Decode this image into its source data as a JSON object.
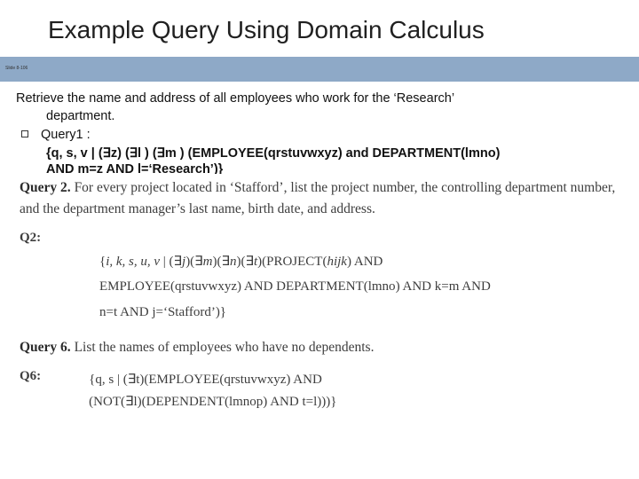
{
  "title": "Example Query Using Domain Calculus",
  "banner": "Slide 8-106",
  "intro_line1": "Retrieve the name and address of all employees who work for the ‘Research’",
  "intro_line2": "department.",
  "bullet_label": "Query1 :",
  "formula_line1": "{q, s, v | (∃z) (∃l ) (∃m ) (EMPLOYEE(qrstuvwxyz) and DEPARTMENT(lmno)",
  "formula_line2": "AND m=z AND l=‘Research’)}",
  "query2": {
    "label": "Query 2.",
    "desc": "For every project located in ‘Stafford’, list the project number, the controlling department number, and the department manager’s last name, birth date, and address.",
    "qlabel": "Q2:",
    "math1_a": "{",
    "math1_vars": "i, k, s, u, v",
    "math1_b": " | (∃",
    "math1_j": "j",
    "math1_c": ")(∃",
    "math1_m": "m",
    "math1_d": ")(∃",
    "math1_n": "n",
    "math1_e": ")(∃",
    "math1_t": "t",
    "math1_f": ")(PROJECT(",
    "math1_hijk": "hijk",
    "math1_g": ") AND",
    "math2_a": "EMPLOYEE(",
    "math2_emp": "qrstuvwxyz",
    "math2_b": ") AND DEPARTMENT(",
    "math2_dept": "lmno",
    "math2_c": ") AND ",
    "math2_km": "k=m",
    "math2_d": " AND",
    "math3_a": "",
    "math3_nt": "n=t",
    "math3_b": " AND ",
    "math3_j": "j",
    "math3_c": "=‘Stafford’)}"
  },
  "query6": {
    "label": "Query 6.",
    "desc": "List the names of employees who have no dependents.",
    "qlabel": "Q6:",
    "math1_a": "{",
    "math1_qs": "q, s",
    "math1_b": " | (∃",
    "math1_t": "t",
    "math1_c": ")(EMPLOYEE(",
    "math1_emp": "qrstuvwxyz",
    "math1_d": ") AND",
    "math2_a": "(NOT(∃",
    "math2_l": "l",
    "math2_b": ")(DEPENDENT(",
    "math2_dep": "lmnop",
    "math2_c": ") AND ",
    "math2_tl": "t=l",
    "math2_d": ")))}"
  }
}
